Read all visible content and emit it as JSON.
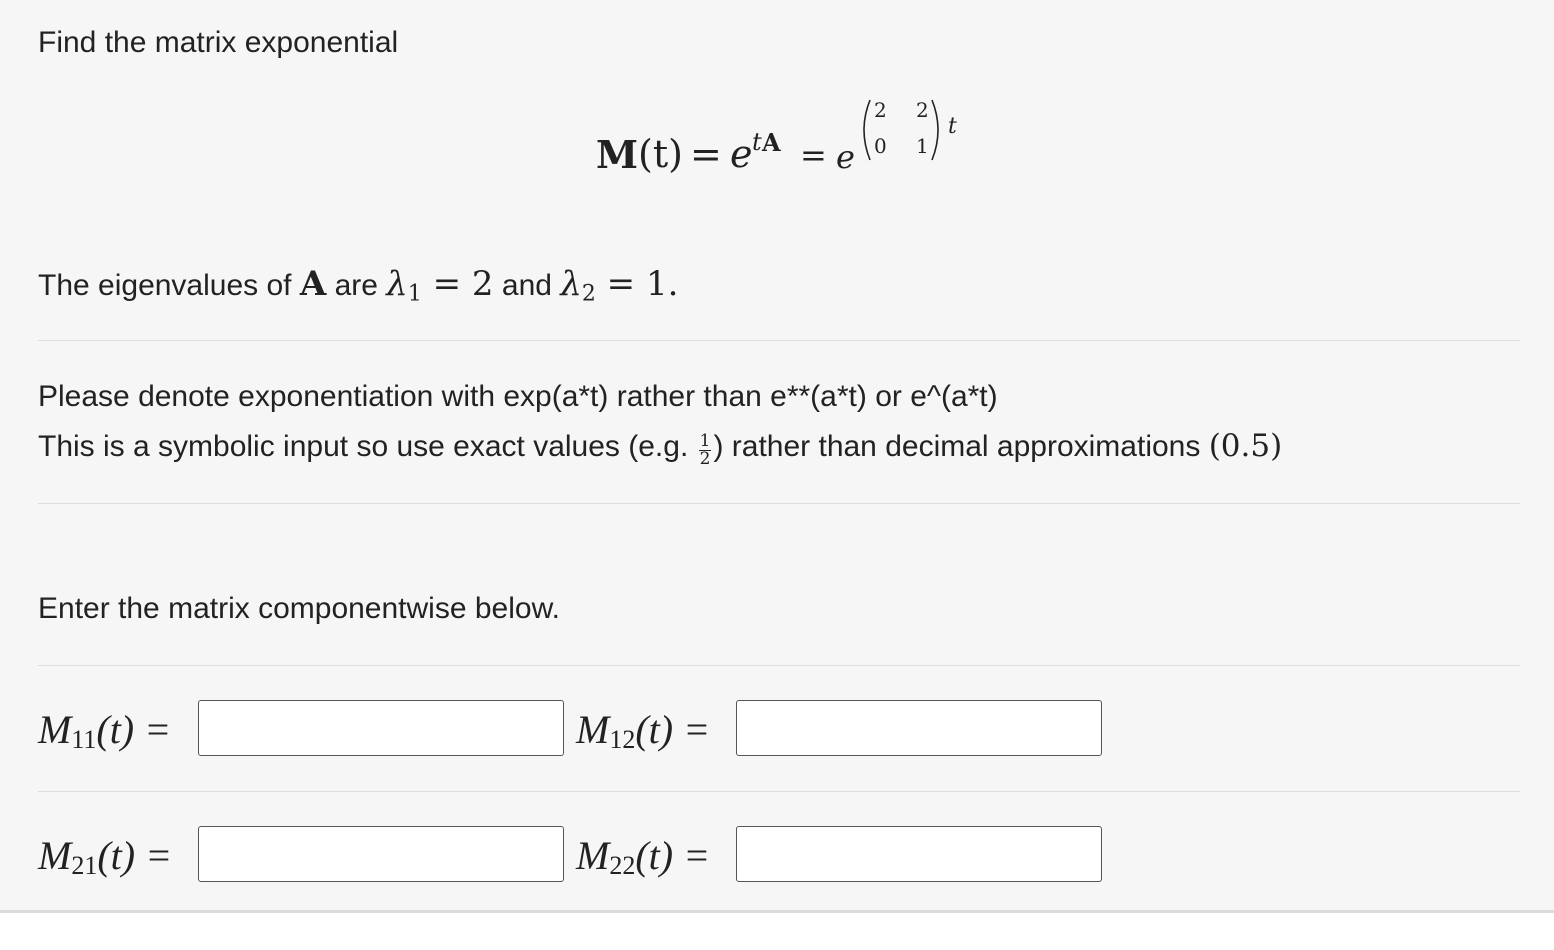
{
  "prompt": {
    "title": "Find the matrix exponential"
  },
  "formula": {
    "lhs_M": "M",
    "lhs_args": "(t)",
    "equals": "=",
    "e_base": "e",
    "tA_t": "t",
    "tA_A": "A",
    "matrix": [
      "2",
      "2",
      "0",
      "1"
    ],
    "exp_t": "t"
  },
  "eigen": {
    "prefix": "The eigenvalues of ",
    "matrix_name": "A",
    "are": " are ",
    "lambda": "λ",
    "lambda1_sub": "1",
    "eq1": " = 2",
    "and": " and ",
    "lambda2_sub": "2",
    "eq2": " = 1."
  },
  "instructions": {
    "line1": "Please denote exponentiation with exp(a*t) rather than e**(a*t) or e^(a*t)",
    "line2_a": "This is a symbolic input so use exact values (e.g. ",
    "frac_num": "1",
    "frac_den": "2",
    "line2_b": ") rather than decimal approximations ",
    "line2_c": "(0.5)"
  },
  "enter": {
    "text": "Enter the matrix componentwise below."
  },
  "fields": {
    "m11": {
      "letter": "M",
      "sub": "11",
      "tail": "(t) =",
      "value": "",
      "placeholder": ""
    },
    "m12": {
      "letter": "M",
      "sub": "12",
      "tail": "(t) =",
      "value": "",
      "placeholder": ""
    },
    "m21": {
      "letter": "M",
      "sub": "21",
      "tail": "(t) =",
      "value": "",
      "placeholder": ""
    },
    "m22": {
      "letter": "M",
      "sub": "22",
      "tail": "(t) =",
      "value": "",
      "placeholder": ""
    }
  }
}
